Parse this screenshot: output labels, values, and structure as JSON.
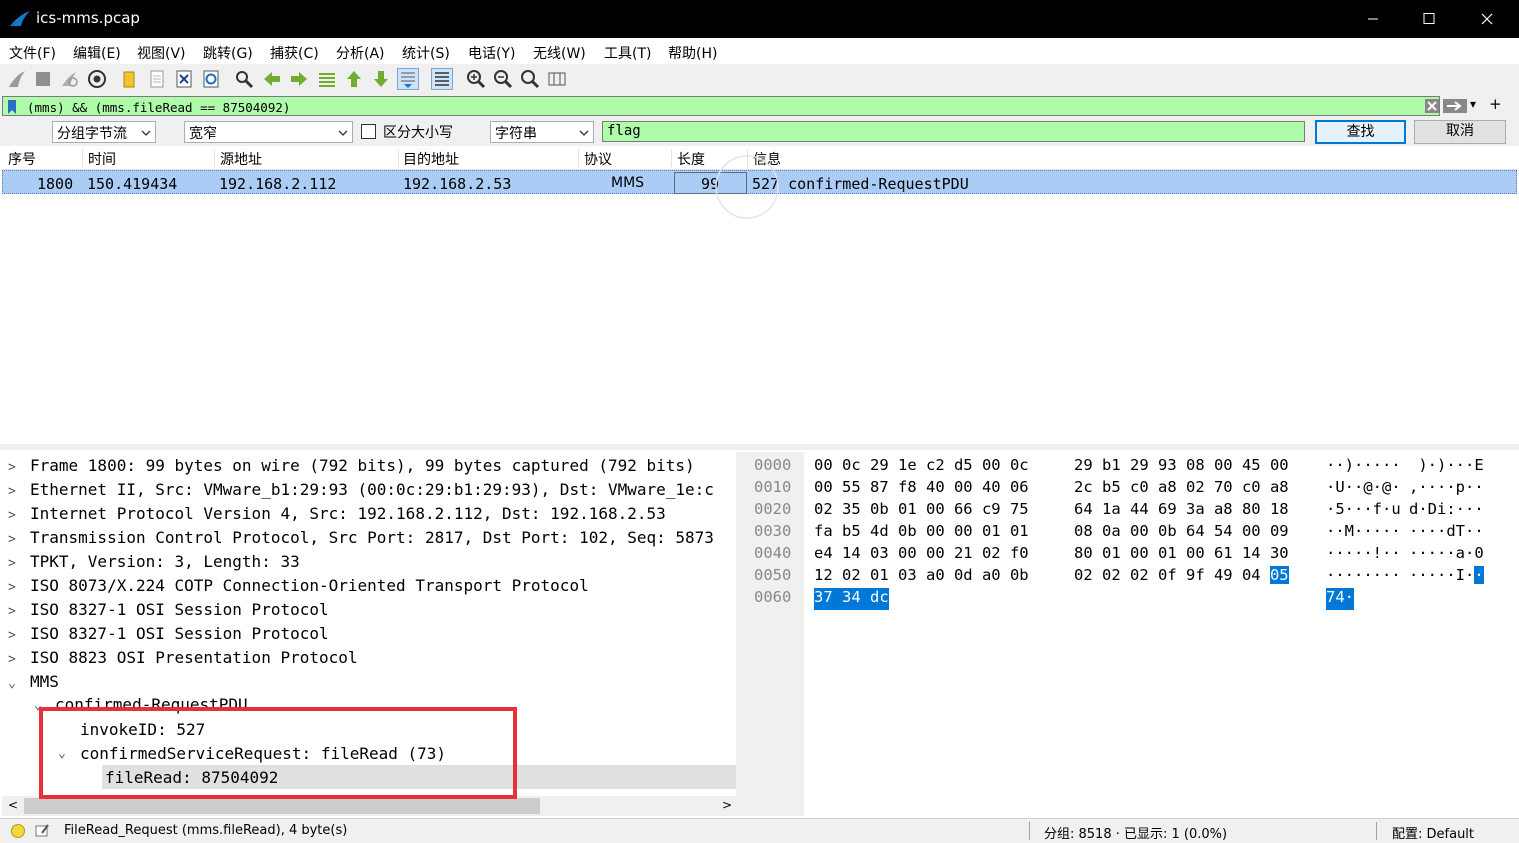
{
  "window": {
    "title": "ics-mms.pcap"
  },
  "menu": [
    "文件(F)",
    "编辑(E)",
    "视图(V)",
    "跳转(G)",
    "捕获(C)",
    "分析(A)",
    "统计(S)",
    "电话(Y)",
    "无线(W)",
    "工具(T)",
    "帮助(H)"
  ],
  "filter": {
    "expression": "(mms) && (mms.fileRead == 87504092)"
  },
  "find": {
    "search_in": "分组字节流",
    "charset": "宽窄",
    "case_sensitive_label": "区分大小写",
    "type": "字符串",
    "value": "flag",
    "find_button": "查找",
    "cancel_button": "取消"
  },
  "packet_list": {
    "columns": [
      "序号",
      "时间",
      "源地址",
      "目的地址",
      "协议",
      "长度",
      "信息"
    ],
    "rows": [
      {
        "no": "1800",
        "time": "150.419434",
        "src": "192.168.2.112",
        "dst": "192.168.2.53",
        "proto": "MMS",
        "len": "99",
        "info": "527 confirmed-RequestPDU"
      }
    ]
  },
  "details": {
    "lines": [
      "Frame 1800: 99 bytes on wire (792 bits), 99 bytes captured (792 bits)",
      "Ethernet II, Src: VMware_b1:29:93 (00:0c:29:b1:29:93), Dst: VMware_1e:c",
      "Internet Protocol Version 4, Src: 192.168.2.112, Dst: 192.168.2.53",
      "Transmission Control Protocol, Src Port: 2817, Dst Port: 102, Seq: 5873",
      "TPKT, Version: 3, Length: 33",
      "ISO 8073/X.224 COTP Connection-Oriented Transport Protocol",
      "ISO 8327-1 OSI Session Protocol",
      "ISO 8327-1 OSI Session Protocol",
      "ISO 8823 OSI Presentation Protocol",
      "MMS",
      "confirmed-RequestPDU",
      "invokeID: 527",
      "confirmedServiceRequest: fileRead (73)",
      "fileRead: 87504092"
    ]
  },
  "hex": {
    "rows": [
      {
        "off": "0000",
        "b1": "00 0c 29 1e c2 d5 00 0c",
        "b2": "29 b1 29 93 08 00 45 00",
        "a1": "··)·····",
        "a2": " )·)···E"
      },
      {
        "off": "0010",
        "b1": "00 55 87 f8 40 00 40 06",
        "b2": "2c b5 c0 a8 02 70 c0 a8",
        "a1": "·U··@·@·",
        "a2": ",····p··"
      },
      {
        "off": "0020",
        "b1": "02 35 0b 01 00 66 c9 75",
        "b2": "64 1a 44 69 3a a8 80 18",
        "a1": "·5···f·u",
        "a2": "d·Di:···"
      },
      {
        "off": "0030",
        "b1": "fa b5 4d 0b 00 00 01 01",
        "b2": "08 0a 00 0b 64 54 00 09",
        "a1": "··M·····",
        "a2": "····dT··"
      },
      {
        "off": "0040",
        "b1": "e4 14 03 00 00 21 02 f0",
        "b2": "80 01 00 01 00 61 14 30",
        "a1": "·····!··",
        "a2": "·····a·0"
      },
      {
        "off": "0050",
        "b1": "12 02 01 03 a0 0d a0 0b",
        "b2": "02 02 02 0f 9f 49 04 ",
        "b2h": "05",
        "a1": "········",
        "a2": "·····I·",
        "a2h": "·"
      },
      {
        "off": "0060",
        "b1h": "37 34 dc",
        "a1h": "74·"
      }
    ]
  },
  "status": {
    "field_info": "FileRead_Request (mms.fileRead), 4 byte(s)",
    "packets": "分组: 8518 · 已显示: 1 (0.0%)",
    "profile": "配置: Default"
  }
}
